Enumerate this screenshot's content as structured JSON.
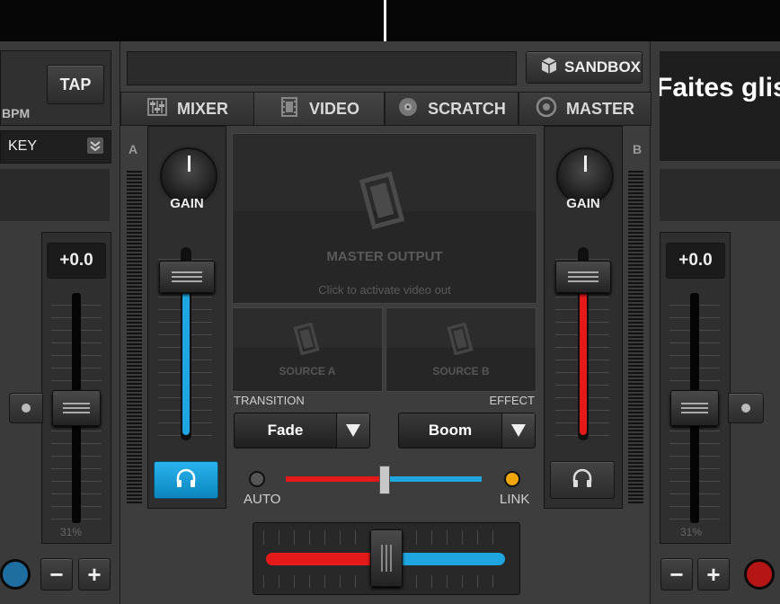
{
  "colors": {
    "accent_blue": "#1fa6e0",
    "accent_red": "#e41a1a",
    "led_orange": "#f1a70b"
  },
  "left_deck": {
    "tap_label": "TAP",
    "bpm_label": "BPM",
    "key_label": "KEY",
    "pitch_value": "+0.0",
    "pitch_percent": "31%"
  },
  "right_deck": {
    "title_text": "Faites glis",
    "pitch_value": "+0.0",
    "pitch_percent": "31%"
  },
  "toolbar": {
    "sandbox_label": "SANDBOX"
  },
  "tabs": [
    {
      "label": "MIXER",
      "icon": "mixer-sliders-icon"
    },
    {
      "label": "VIDEO",
      "icon": "film-strip-icon"
    },
    {
      "label": "SCRATCH",
      "icon": "vinyl-disc-icon"
    },
    {
      "label": "MASTER",
      "icon": "target-icon"
    }
  ],
  "mixer": {
    "channel_a_letter": "A",
    "channel_b_letter": "B",
    "gain_label": "GAIN",
    "channel_a_volume_level": 0.82,
    "channel_b_volume_level": 0.82
  },
  "video": {
    "master_output_label": "MASTER OUTPUT",
    "master_hint": "Click to activate video out",
    "source_a_label": "SOURCE A",
    "source_b_label": "SOURCE B",
    "transition_label": "TRANSITION",
    "effect_label": "EFFECT",
    "transition_value": "Fade",
    "effect_value": "Boom",
    "auto_label": "AUTO",
    "link_label": "LINK",
    "video_crossfader_position": 0.5
  },
  "crossfader": {
    "position": 0.5
  },
  "stepper": {
    "minus": "−",
    "plus": "+"
  }
}
